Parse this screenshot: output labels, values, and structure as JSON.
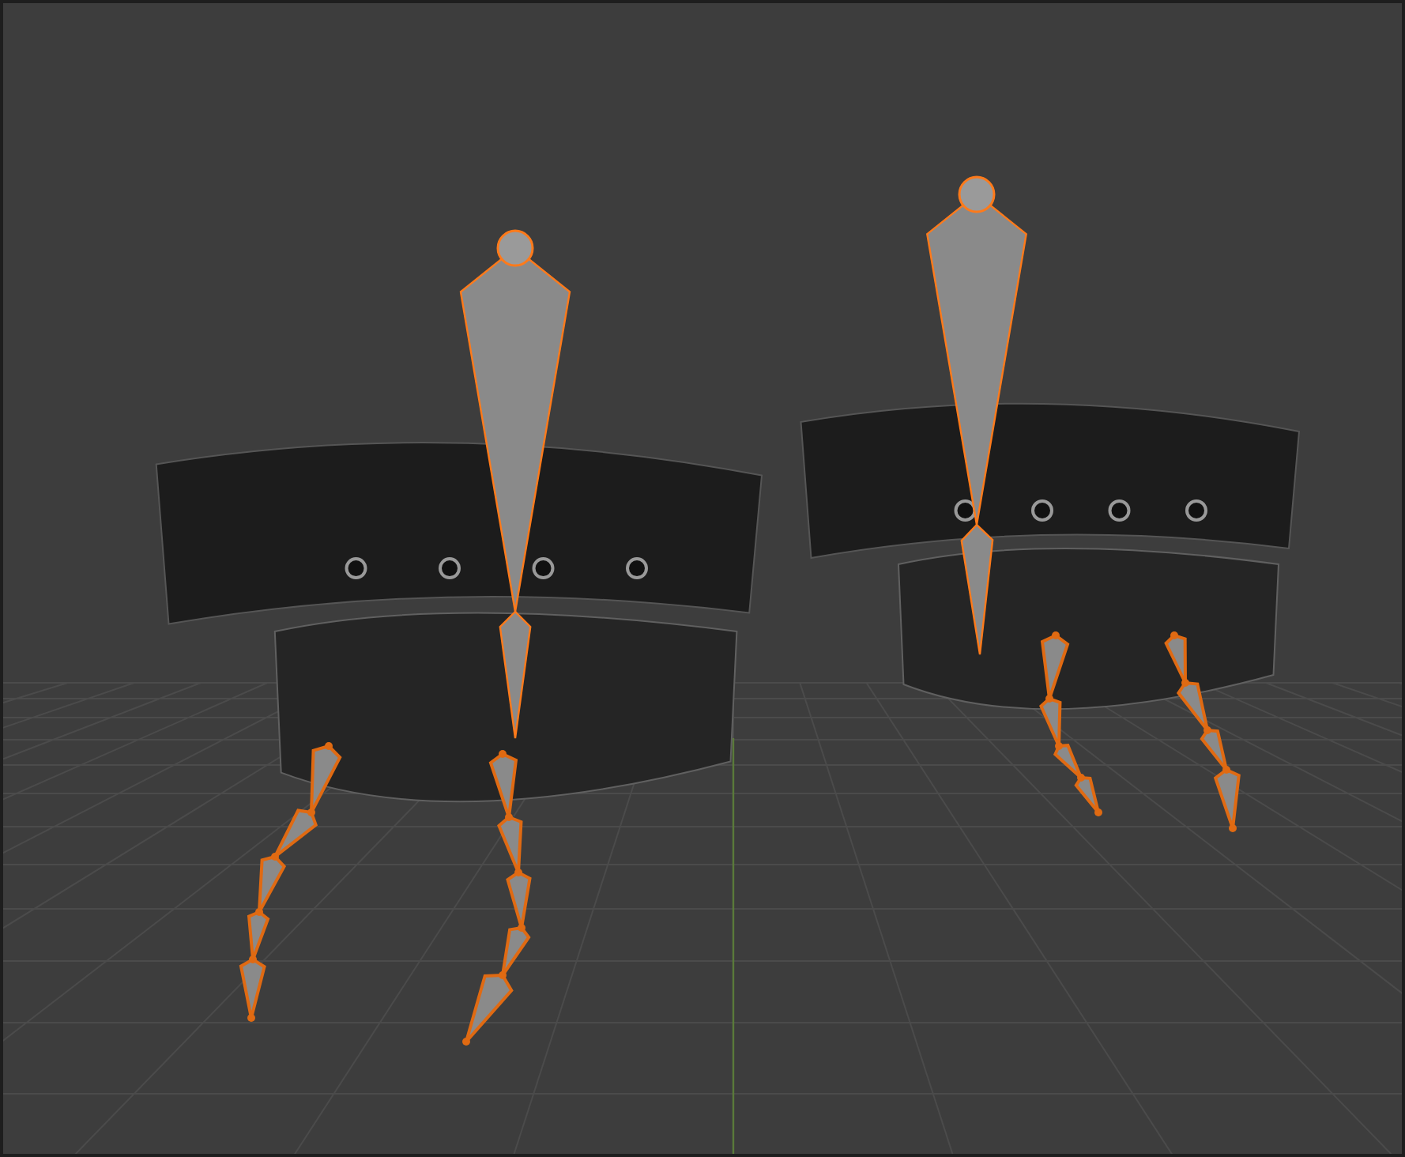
{
  "viewport": {
    "armatures": [
      {
        "selected": true
      },
      {
        "selected": true
      }
    ]
  }
}
